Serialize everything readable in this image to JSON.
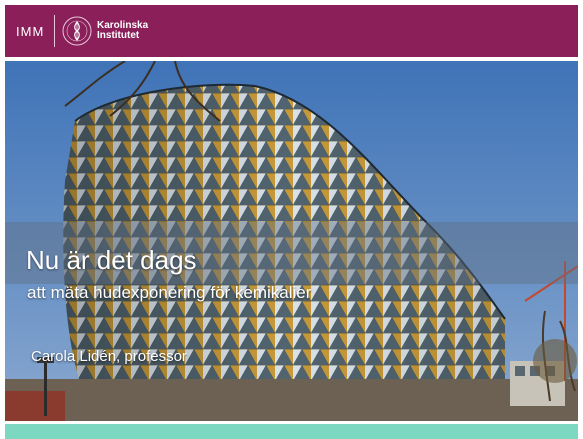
{
  "header": {
    "department": "IMM",
    "institution_line1": "Karolinska",
    "institution_line2": "Institutet",
    "seal_icon": "karolinska-seal-icon"
  },
  "slide": {
    "title": "Nu är det dags",
    "subtitle": "att mäta hudexponering för kemikalier",
    "author": "Carola Lidén, professor"
  },
  "colors": {
    "header": "#8a1f5a",
    "footer": "#7dd8c2",
    "sky": "#4f7fb8"
  }
}
